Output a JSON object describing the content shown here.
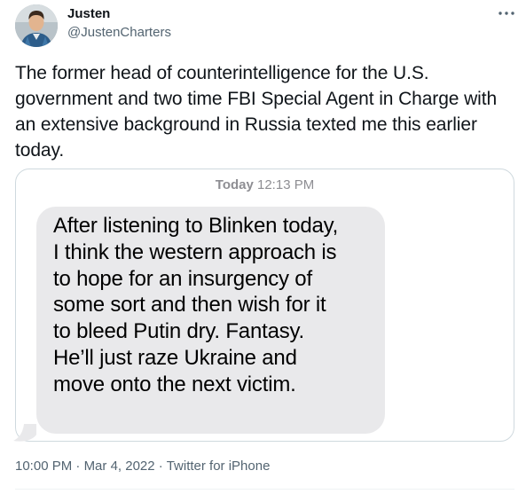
{
  "author": {
    "display_name": "Justen",
    "handle": "@JustenCharters",
    "avatar_icon": "person-avatar-icon"
  },
  "menu": {
    "more_icon": "more-horizontal-icon"
  },
  "tweet": {
    "text": "The former head of counterintelligence for the U.S. government and two time FBI Special Agent in Charge with an extensive background in Russia texted me this earlier today."
  },
  "screenshot_message": {
    "day": "Today",
    "time": "12:13 PM",
    "body": "After listening to Blinken today,\nI think the western approach is\nto hope for an insurgency of\nsome sort and then wish for it\nto bleed Putin dry.  Fantasy.\nHe’ll just raze Ukraine and\nmove onto the next victim.",
    "bubble_color": "#e9e9eb"
  },
  "footer": {
    "time": "10:00 PM",
    "separator": "·",
    "date": "Mar 4, 2022",
    "source": "Twitter for iPhone"
  },
  "colors": {
    "text": "#0f1419",
    "secondary": "#536471",
    "border": "#cfd9de"
  }
}
